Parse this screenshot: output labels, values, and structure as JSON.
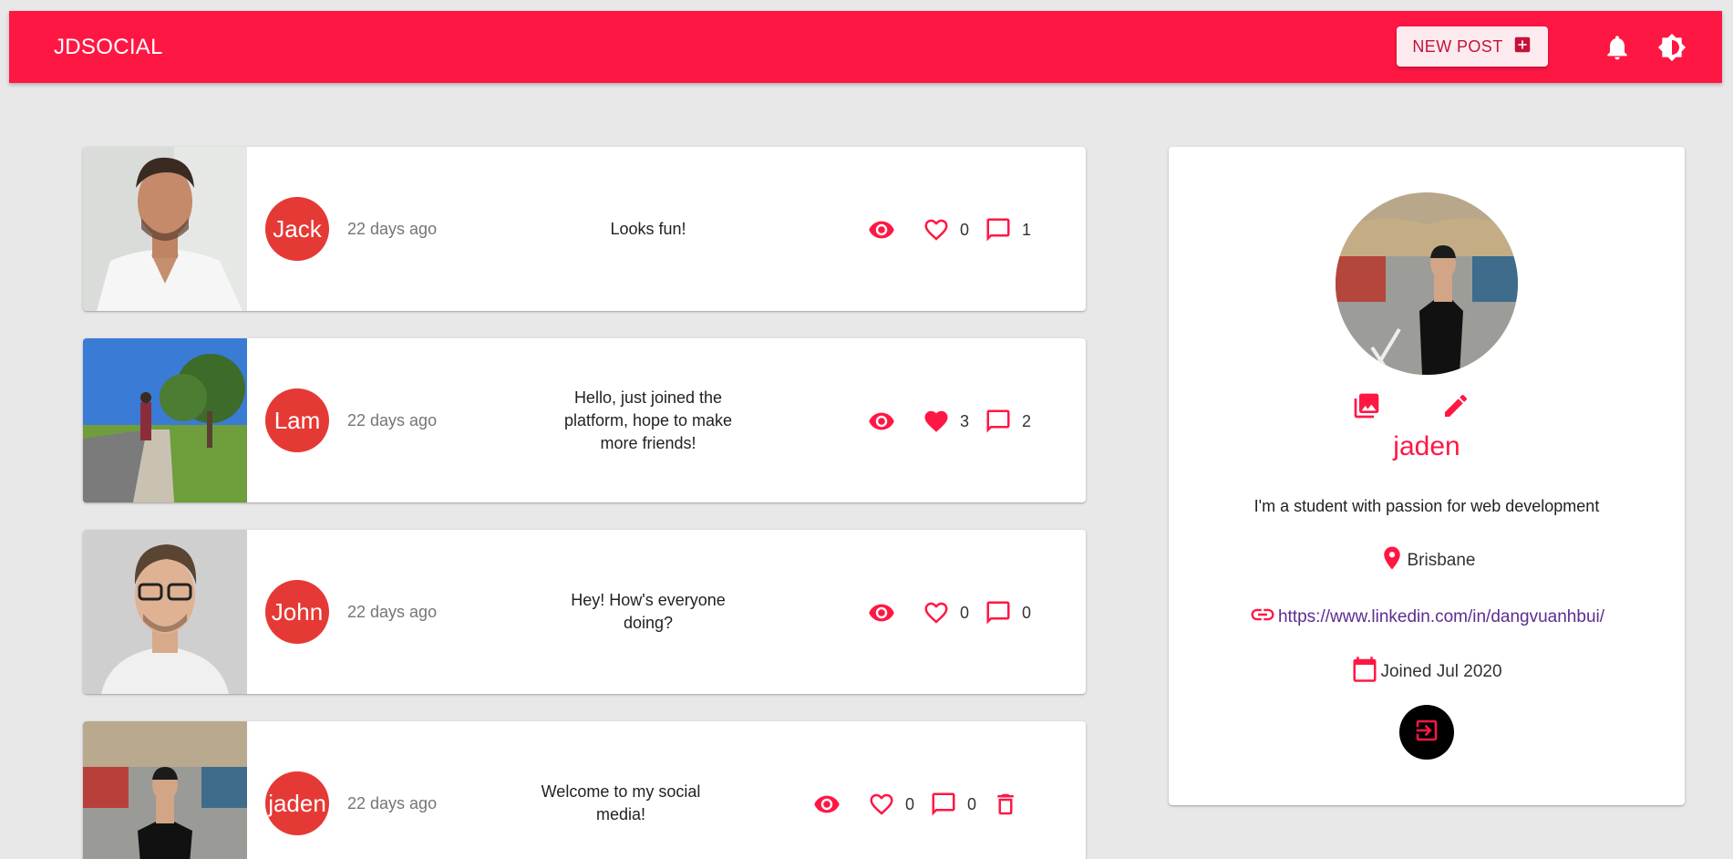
{
  "app": {
    "brand": "JDSOCIAL",
    "new_post_label": "NEW POST",
    "accent_color": "#ff1744"
  },
  "posts": [
    {
      "author": "Jack",
      "date": "22 days ago",
      "body": "Looks fun!",
      "likes": "0",
      "comments": "1",
      "liked": false
    },
    {
      "author": "Lam",
      "date": "22 days ago",
      "body": "Hello, just joined the platform, hope to make more friends!",
      "likes": "3",
      "comments": "2",
      "liked": true
    },
    {
      "author": "John",
      "date": "22 days ago",
      "body": "Hey! How's everyone doing?",
      "likes": "0",
      "comments": "0",
      "liked": false
    },
    {
      "author": "jaden",
      "date": "22 days ago",
      "body": "Welcome to my social media!",
      "likes": "0",
      "comments": "0",
      "liked": false,
      "deletable": true
    }
  ],
  "profile": {
    "handle": "jaden",
    "bio": "I'm a student with passion for web development",
    "location": "Brisbane",
    "website": "https://www.linkedin.com/in/dangvuanhbui/",
    "joined": "Joined Jul 2020"
  },
  "icons": {
    "new_post": "add-box-icon",
    "notifications": "bell-icon",
    "theme": "brightness-icon",
    "view": "eye-icon",
    "like": "heart-icon",
    "comment": "chat-bubble-icon",
    "delete": "trash-icon",
    "change_image": "image-icon",
    "edit": "pencil-icon",
    "location": "location-pin-icon",
    "link": "link-icon",
    "calendar": "calendar-icon",
    "logout": "logout-icon"
  }
}
